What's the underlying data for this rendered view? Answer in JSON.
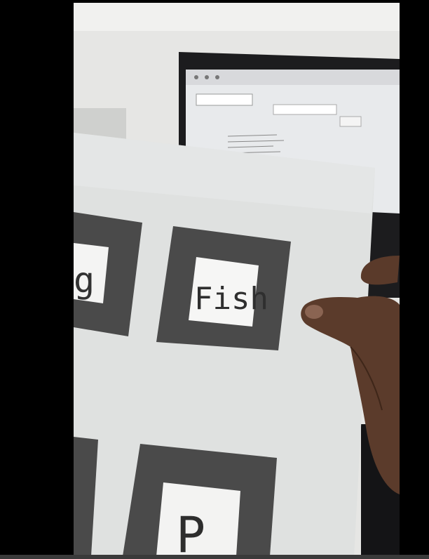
{
  "scene": {
    "marker_words": [
      "g",
      "Fish",
      "P"
    ],
    "colors": {
      "backdrop": "#000000",
      "wall": "#e9e9e7",
      "paper": "#dfe1e0",
      "marker_frame": "#4a4a4a",
      "skin": "#5a3a2a",
      "laptop": "#1c1c1e"
    }
  }
}
